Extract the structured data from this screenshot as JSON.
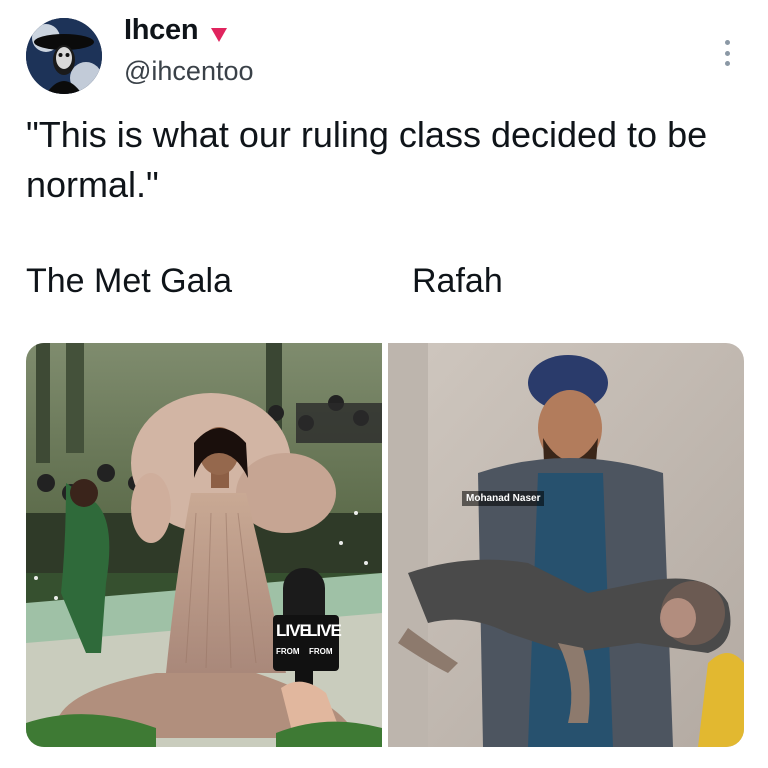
{
  "author": {
    "display_name": "Ihcen",
    "handle": "@ihcentoo",
    "verified_icon": "red-triangle-icon",
    "verified_color": "#e0245e"
  },
  "tweet": {
    "text": "\"This is what our ruling class decided to be normal.\""
  },
  "comparison": {
    "left_caption": "The Met Gala",
    "right_caption": "Rafah"
  },
  "left_image": {
    "mic_logo_line1_a": "LIVE",
    "mic_logo_line1_b": "LIVE",
    "mic_logo_line2_a": "FROM",
    "mic_logo_line2_b": "FROM"
  },
  "right_image": {
    "watermark": "Mohanad Naser"
  },
  "menu": {
    "icon": "more-vertical-icon"
  }
}
